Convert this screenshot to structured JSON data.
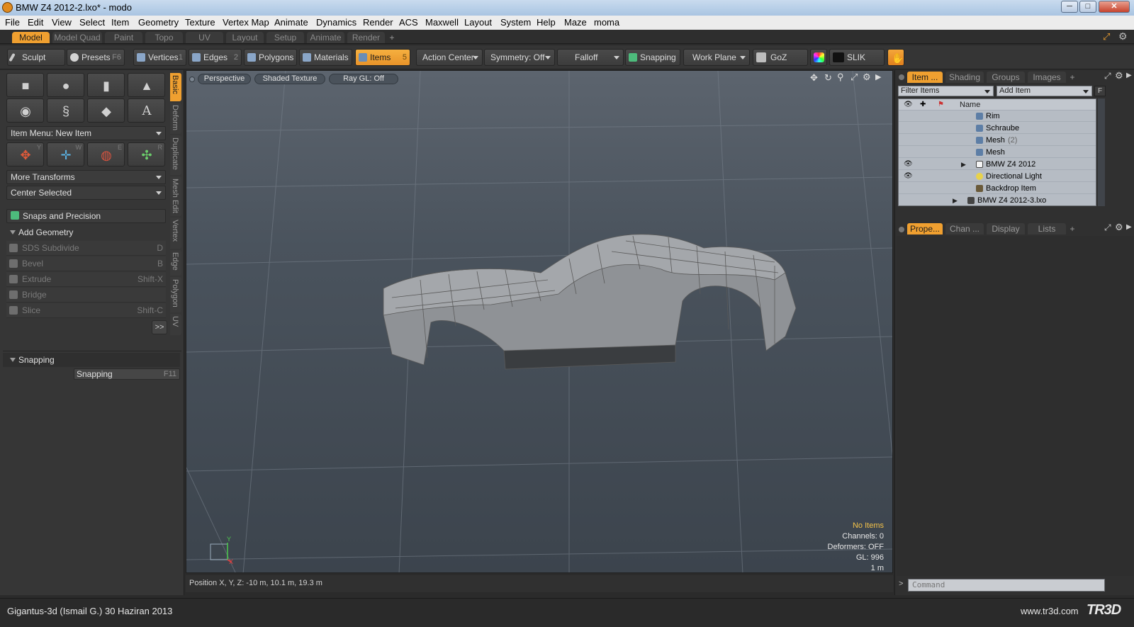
{
  "window": {
    "title": "BMW Z4 2012-2.lxo* - modo",
    "minimize": "─",
    "maximize": "□",
    "close": "✕"
  },
  "menu": [
    "File",
    "Edit",
    "View",
    "Select",
    "Item",
    "Geometry",
    "Texture",
    "Vertex Map",
    "Animate",
    "Dynamics",
    "Render",
    "ACS",
    "Maxwell",
    "Layout",
    "System",
    "Help",
    "Maze",
    "moma"
  ],
  "layout_tabs": [
    "Model",
    "Model Quad",
    "Paint",
    "Topo",
    "UV",
    "Layout",
    "Setup",
    "Animate",
    "Render",
    "+"
  ],
  "toolbar": {
    "sculpt": "Sculpt",
    "presets": "Presets",
    "presets_key": "F6",
    "vertices": "Vertices",
    "vertices_key": "1",
    "edges": "Edges",
    "edges_key": "2",
    "polygons": "Polygons",
    "materials": "Materials",
    "items": "Items",
    "items_key": "5",
    "action_center": "Action Center",
    "symmetry": "Symmetry: Off",
    "falloff": "Falloff",
    "snapping": "Snapping",
    "work_plane": "Work Plane",
    "goz": "GoZ",
    "slik": "SLIK"
  },
  "left_panel": {
    "tool_keys": [
      "Y",
      "W",
      "E",
      "R"
    ],
    "item_menu": "Item Menu: New Item",
    "more_transforms": "More Transforms",
    "center_selected": "Center Selected",
    "snaps_precision": "Snaps and Precision",
    "add_geometry": "Add Geometry",
    "geometry": [
      {
        "label": "SDS Subdivide",
        "key": "D"
      },
      {
        "label": "Bevel",
        "key": "B"
      },
      {
        "label": "Extrude",
        "key": "Shift-X"
      },
      {
        "label": "Bridge",
        "key": ""
      },
      {
        "label": "Slice",
        "key": "Shift-C"
      }
    ],
    "more_btn": ">>",
    "snapping_header": "Snapping",
    "snapping_btn": "Snapping",
    "snapping_key": "F11",
    "vtabs": [
      "Basic",
      "Deform",
      "Duplicate",
      "Mesh Edit",
      "Vertex",
      "Edge",
      "Polygon",
      "UV"
    ]
  },
  "viewport": {
    "perspective": "Perspective",
    "shading": "Shaded Texture",
    "raygl": "Ray GL: Off",
    "hud": {
      "no_items": "No Items",
      "channels": "Channels: 0",
      "deformers": "Deformers: OFF",
      "gl": "GL: 996",
      "scale": "1 m"
    },
    "axis_y": "Y",
    "axis_x": "X",
    "position": "Position X, Y, Z:   -10 m, 10.1 m, 19.3 m",
    "colors": {
      "no_items": "#f3c24a"
    }
  },
  "right_panel": {
    "top_tabs": [
      "Item ...",
      "Shading",
      "Groups",
      "Images",
      "+"
    ],
    "filter": "Filter Items",
    "add_item": "Add Item",
    "f_btn": "F",
    "name_header": "Name",
    "tree": [
      {
        "label": "Rim",
        "visible": false
      },
      {
        "label": "Schraube",
        "visible": false
      },
      {
        "label": "Mesh",
        "extra": "(2)",
        "visible": false
      },
      {
        "label": "Mesh",
        "visible": false
      },
      {
        "label": "BMW Z4 2012",
        "visible": true
      },
      {
        "label": "Directional Light",
        "visible": true
      },
      {
        "label": "Backdrop Item",
        "visible": false
      },
      {
        "label": "BMW Z4 2012-3.lxo",
        "visible": false
      }
    ],
    "bottom_tabs": [
      "Prope...",
      "Chan ...",
      "Display",
      "Lists",
      "+"
    ],
    "command_prompt": ">",
    "command_placeholder": "Command"
  },
  "footer": {
    "credit": "Gigantus-3d (Ismail G.)  30 Haziran 2013",
    "site": "www.tr3d.com",
    "logo": "TR3D"
  }
}
